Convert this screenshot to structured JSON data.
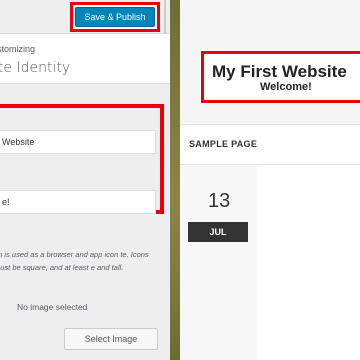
{
  "header": {
    "publish_label": "Save & Publish"
  },
  "panel": {
    "customizing_label": "ustomizing",
    "section_title": "ite Identity"
  },
  "fields": {
    "site_title_value": "Website",
    "tagline_value": "e!"
  },
  "site_icon": {
    "description": "on is used as a browser and app icon te. Icons must be square, and at least e and tall.",
    "no_image_text": "No image selected",
    "select_image_label": "Select Image"
  },
  "preview": {
    "site_title": "My First Website",
    "site_tagline": "Welcome!",
    "nav_item": "SAMPLE PAGE",
    "date_day": "13",
    "date_month": "JUL"
  },
  "colors": {
    "highlight_outline": "#e8000b",
    "publish_button": "#0085ba"
  }
}
